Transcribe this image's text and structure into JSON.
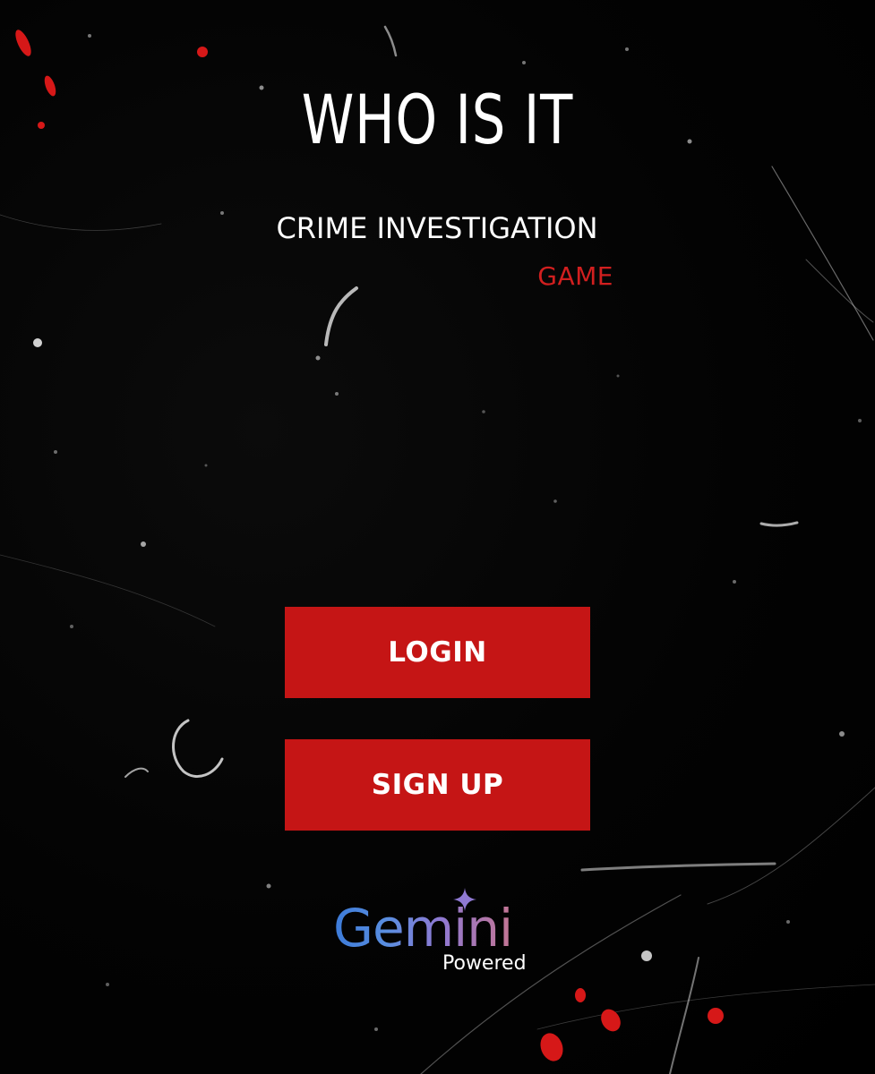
{
  "title": "WHO IS IT",
  "subtitle": "CRIME INVESTIGATION",
  "tag": "GAME",
  "buttons": {
    "login": "LOGIN",
    "signup": "SIGN UP"
  },
  "badge": {
    "brand": "Gemini",
    "sub": "Powered"
  },
  "colors": {
    "background": "#020202",
    "accent_red": "#c51515",
    "tag_red": "#d11f1f",
    "text": "#ffffff"
  },
  "icons": {
    "badge_spark": "sparkle-icon"
  }
}
